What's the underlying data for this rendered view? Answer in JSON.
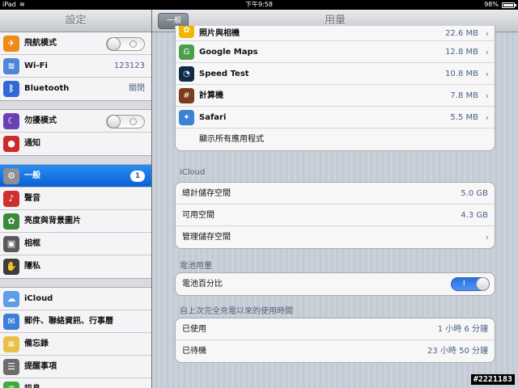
{
  "status_bar": {
    "carrier": "iPad",
    "time": "下午9:58",
    "battery": "98%"
  },
  "master": {
    "title": "設定",
    "groups": [
      [
        {
          "label": "飛航模式",
          "icon": "airplane-icon",
          "color": "#f08a17",
          "glyph": "✈",
          "switch": "off"
        },
        {
          "label": "Wi-Fi",
          "icon": "wifi-icon",
          "color": "#4f86d8",
          "glyph": "≋",
          "value": "123123"
        },
        {
          "label": "Bluetooth",
          "icon": "bluetooth-icon",
          "color": "#2f6ad6",
          "glyph": "ᛒ",
          "value": "關閉"
        }
      ],
      [
        {
          "label": "勿擾模式",
          "icon": "moon-icon",
          "color": "#6d3fb4",
          "glyph": "☾",
          "switch": "off"
        },
        {
          "label": "通知",
          "icon": "notification-icon",
          "color": "#cc2b2b",
          "glyph": "●"
        }
      ],
      [
        {
          "label": "一般",
          "icon": "gear-icon",
          "color": "#8e8e93",
          "glyph": "⚙",
          "badge": "1",
          "selected": true
        },
        {
          "label": "聲音",
          "icon": "speaker-icon",
          "color": "#cf2f2f",
          "glyph": "♪"
        },
        {
          "label": "亮度與背景圖片",
          "icon": "flower-icon",
          "color": "#3b8a3b",
          "glyph": "✿"
        },
        {
          "label": "相框",
          "icon": "picture-frame-icon",
          "color": "#5a5a5a",
          "glyph": "▣"
        },
        {
          "label": "隱私",
          "icon": "hand-icon",
          "color": "#3d3d3d",
          "glyph": "✋"
        }
      ],
      [
        {
          "label": "iCloud",
          "icon": "cloud-icon",
          "color": "#5d9ee8",
          "glyph": "☁"
        },
        {
          "label": "郵件、聯絡資訊、行事曆",
          "icon": "mail-icon",
          "color": "#3b7fd8",
          "glyph": "✉"
        },
        {
          "label": "備忘錄",
          "icon": "notes-icon",
          "color": "#e7c04a",
          "glyph": "≡"
        },
        {
          "label": "提醒事項",
          "icon": "reminders-icon",
          "color": "#6c6c6c",
          "glyph": "☰"
        },
        {
          "label": "訊息",
          "icon": "messages-icon",
          "color": "#3faa3f",
          "glyph": "✆"
        }
      ]
    ]
  },
  "detail": {
    "title": "用量",
    "back_label": "一般",
    "apps": [
      {
        "name": "照片與相機",
        "size": "22.6 MB",
        "icon": "photos-icon",
        "color": "#f2b500",
        "glyph": "✿"
      },
      {
        "name": "Google Maps",
        "size": "12.8 MB",
        "icon": "google-maps-icon",
        "color": "#4aa04a",
        "glyph": "G"
      },
      {
        "name": "Speed Test",
        "size": "10.8 MB",
        "icon": "speedometer-icon",
        "color": "#0f2b4a",
        "glyph": "◔"
      },
      {
        "name": "計算機",
        "size": "7.8 MB",
        "icon": "calculator-icon",
        "color": "#7a3c1c",
        "glyph": "#"
      },
      {
        "name": "Safari",
        "size": "5.5 MB",
        "icon": "compass-icon",
        "color": "#3b82d6",
        "glyph": "✦"
      }
    ],
    "show_all_apps": "顯示所有應用程式",
    "icloud": {
      "header": "iCloud",
      "total_label": "總計儲存空間",
      "total_value": "5.0 GB",
      "available_label": "可用空間",
      "available_value": "4.3 GB",
      "manage_label": "管理儲存空間"
    },
    "battery": {
      "header": "電池用量",
      "percent_label": "電池百分比",
      "switch_text": "I"
    },
    "since_charge": {
      "header": "自上次完全充電以來的使用時間",
      "usage_label": "已使用",
      "usage_value": "1 小時 6 分鐘",
      "standby_label": "已待機",
      "standby_value": "23 小時 50 分鐘"
    }
  },
  "watermark": "#2221183"
}
